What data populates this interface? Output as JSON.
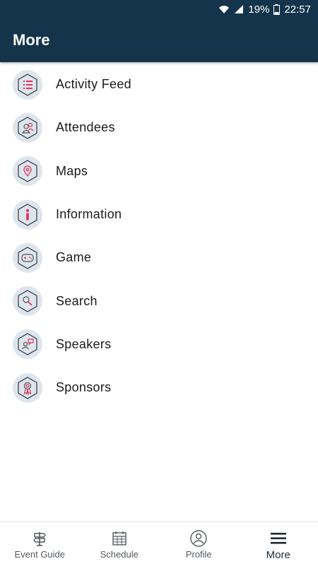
{
  "status_bar": {
    "battery": "19%",
    "time": "22:57"
  },
  "app_bar": {
    "title": "More"
  },
  "menu": {
    "items": [
      {
        "label": "Activity Feed",
        "icon": "activity-feed-icon"
      },
      {
        "label": "Attendees",
        "icon": "attendees-icon"
      },
      {
        "label": "Maps",
        "icon": "map-pin-icon"
      },
      {
        "label": "Information",
        "icon": "info-icon"
      },
      {
        "label": "Game",
        "icon": "game-controller-icon"
      },
      {
        "label": "Search",
        "icon": "search-icon"
      },
      {
        "label": "Speakers",
        "icon": "speaker-icon"
      },
      {
        "label": "Sponsors",
        "icon": "award-ribbon-icon"
      }
    ]
  },
  "bottom_nav": {
    "items": [
      {
        "label": "Event Guide",
        "icon": "signpost-icon"
      },
      {
        "label": "Schedule",
        "icon": "calendar-icon"
      },
      {
        "label": "Profile",
        "icon": "profile-icon"
      },
      {
        "label": "More",
        "icon": "hamburger-menu-icon"
      }
    ],
    "active": "More"
  },
  "colors": {
    "header": "#14344b",
    "accent": "#e0325a",
    "icon_bg": "#dfe5ec"
  }
}
